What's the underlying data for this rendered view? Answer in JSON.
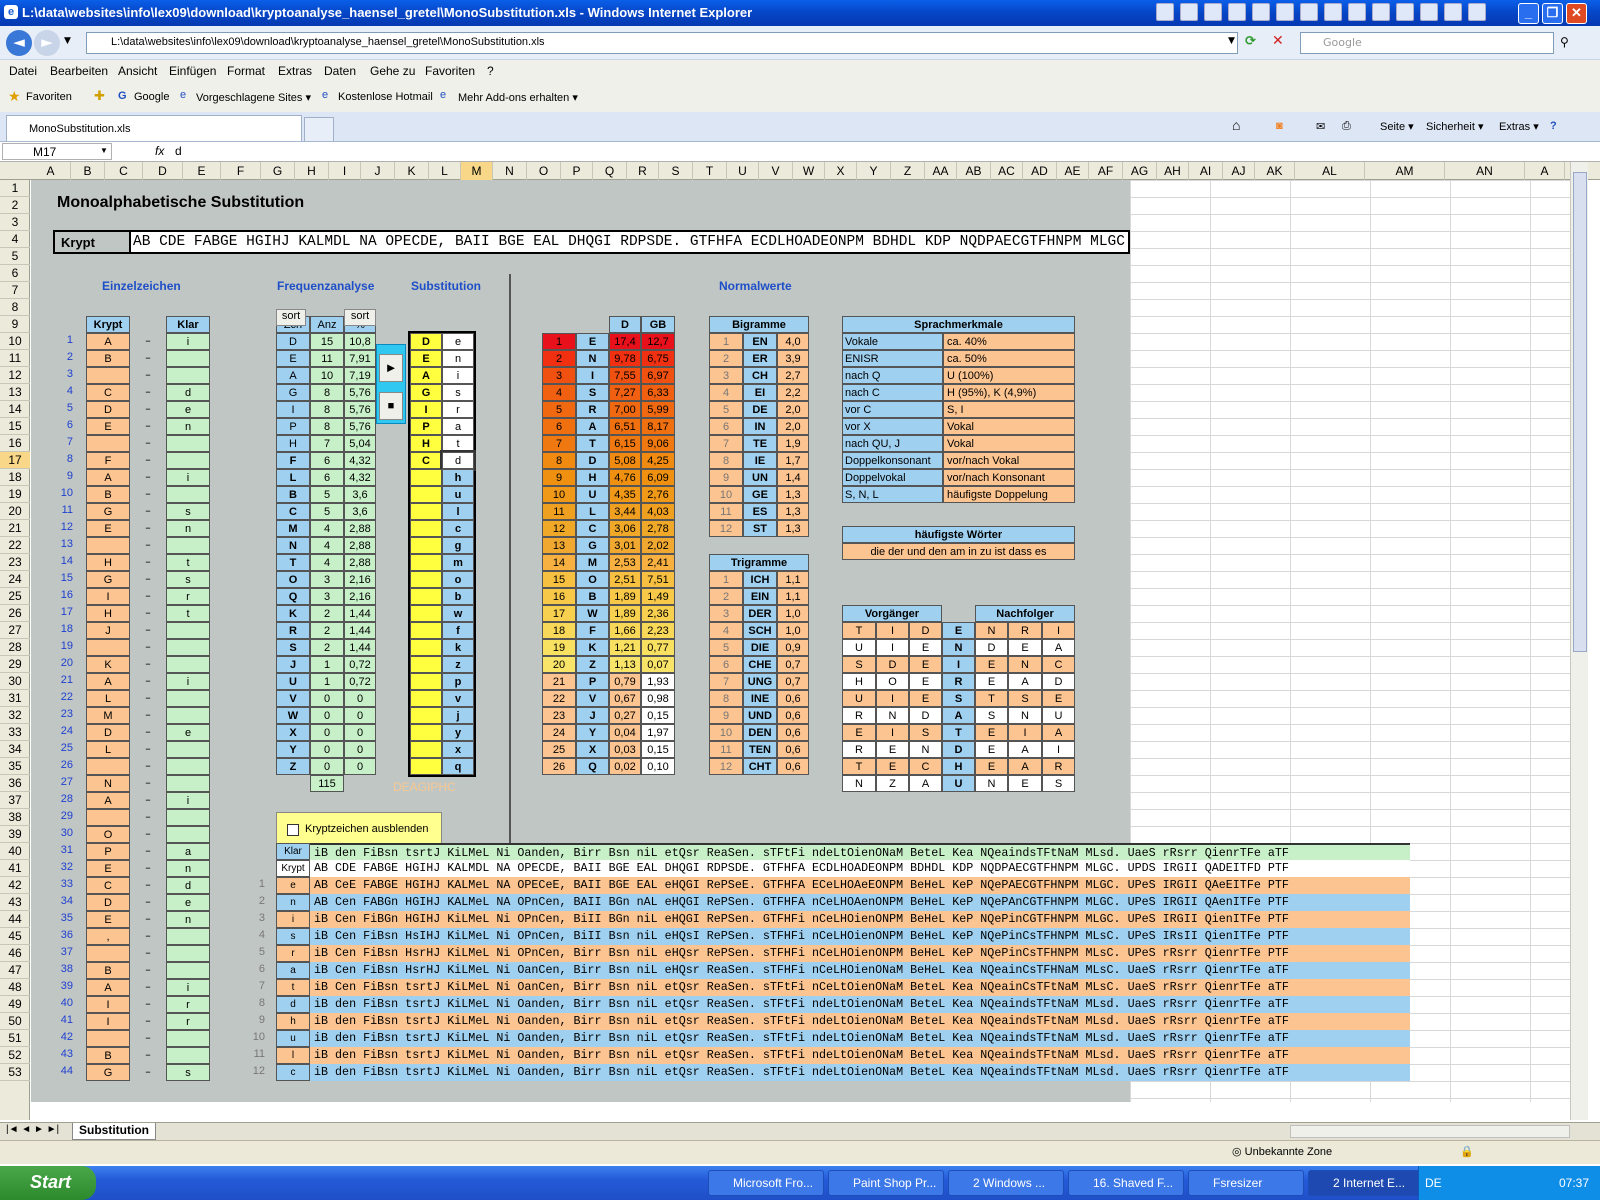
{
  "window": {
    "title": "L:\\data\\websites\\info\\lex09\\download\\kryptoanalyse_haensel_gretel\\MonoSubstitution.xls - Windows Internet Explorer"
  },
  "address": {
    "url": "L:\\data\\websites\\info\\lex09\\download\\kryptoanalyse_haensel_gretel\\MonoSubstitution.xls",
    "search_placeholder": "Google"
  },
  "menu": [
    "Datei",
    "Bearbeiten",
    "Ansicht",
    "Einfügen",
    "Format",
    "Extras",
    "Daten",
    "Gehe zu",
    "Favoriten",
    "?"
  ],
  "favorites": {
    "label": "Favoriten",
    "items": [
      "Google",
      "Vorgeschlagene Sites ▾",
      "Kostenlose Hotmail",
      "Mehr Add-ons erhalten ▾"
    ]
  },
  "tab": {
    "label": "MonoSubstitution.xls"
  },
  "toolbar": {
    "seite": "Seite ▾",
    "sicherheit": "Sicherheit ▾",
    "extras": "Extras ▾"
  },
  "formula": {
    "cell": "M17",
    "fx": "fx",
    "value": "d"
  },
  "columns": [
    "A",
    "B",
    "C",
    "D",
    "E",
    "F",
    "G",
    "H",
    "I",
    "J",
    "K",
    "L",
    "M",
    "N",
    "O",
    "P",
    "Q",
    "R",
    "S",
    "T",
    "U",
    "V",
    "W",
    "X",
    "Y",
    "Z",
    "AA",
    "AB",
    "AC",
    "AD",
    "AE",
    "AF",
    "AG",
    "AH",
    "AI",
    "AJ",
    "AK",
    "AL",
    "AM",
    "AN",
    "A"
  ],
  "rows": [
    "1",
    "2",
    "3",
    "4",
    "5",
    "6",
    "7",
    "8",
    "9",
    "10",
    "11",
    "12",
    "13",
    "14",
    "15",
    "16",
    "17",
    "18",
    "19",
    "20",
    "21",
    "22",
    "23",
    "24",
    "25",
    "26",
    "27",
    "28",
    "29",
    "30",
    "31",
    "32",
    "33",
    "34",
    "35",
    "36",
    "37",
    "38",
    "39",
    "40",
    "41",
    "42",
    "43",
    "44",
    "45",
    "46",
    "47",
    "48",
    "49",
    "50",
    "51",
    "52",
    "53"
  ],
  "sheet": {
    "title": "Monoalphabetische Substitution",
    "krypt_label": "Krypt",
    "krypt_text": "AB CDE FABGE HGIHJ KALMDL NA OPECDE, BAII BGE EAL DHQGI RDPSDE. GTFHFA ECDLHOADEONPM BDHDL KDP NQDPAECGTFHNPM MLGC. UPDS IRGII QADE",
    "sec_einzel": "Einzelzeichen",
    "sec_freq": "Frequenzanalyse",
    "sec_subst": "Substitution",
    "sec_normal": "Normalwerte",
    "einzel_hdr": [
      "Krypt",
      "Klar"
    ],
    "einzel": [
      [
        "1",
        "A",
        "i"
      ],
      [
        "2",
        "B",
        ""
      ],
      [
        "3",
        "",
        ""
      ],
      [
        "4",
        "C",
        "d"
      ],
      [
        "5",
        "D",
        "e"
      ],
      [
        "6",
        "E",
        "n"
      ],
      [
        "7",
        "",
        ""
      ],
      [
        "8",
        "F",
        ""
      ],
      [
        "9",
        "A",
        "i"
      ],
      [
        "10",
        "B",
        ""
      ],
      [
        "11",
        "G",
        "s"
      ],
      [
        "12",
        "E",
        "n"
      ],
      [
        "13",
        "",
        ""
      ],
      [
        "14",
        "H",
        "t"
      ],
      [
        "15",
        "G",
        "s"
      ],
      [
        "16",
        "I",
        "r"
      ],
      [
        "17",
        "H",
        "t"
      ],
      [
        "18",
        "J",
        ""
      ],
      [
        "19",
        "",
        ""
      ],
      [
        "20",
        "K",
        ""
      ],
      [
        "21",
        "A",
        "i"
      ],
      [
        "22",
        "L",
        ""
      ],
      [
        "23",
        "M",
        ""
      ],
      [
        "24",
        "D",
        "e"
      ],
      [
        "25",
        "L",
        ""
      ],
      [
        "26",
        "",
        ""
      ],
      [
        "27",
        "N",
        ""
      ],
      [
        "28",
        "A",
        "i"
      ],
      [
        "29",
        "",
        ""
      ],
      [
        "30",
        "O",
        ""
      ],
      [
        "31",
        "P",
        "a"
      ],
      [
        "32",
        "E",
        "n"
      ],
      [
        "33",
        "C",
        "d"
      ],
      [
        "34",
        "D",
        "e"
      ],
      [
        "35",
        "E",
        "n"
      ],
      [
        "36",
        ",",
        ""
      ],
      [
        "37",
        "",
        ""
      ],
      [
        "38",
        "B",
        ""
      ],
      [
        "39",
        "A",
        "i"
      ],
      [
        "40",
        "I",
        "r"
      ],
      [
        "41",
        "I",
        "r"
      ],
      [
        "42",
        "",
        ""
      ],
      [
        "43",
        "B",
        ""
      ],
      [
        "44",
        "G",
        "s"
      ]
    ],
    "sort_label": "sort",
    "freq_hdr": [
      "Zch",
      "Anz",
      "%"
    ],
    "freq": [
      [
        "D",
        "15",
        "10,8"
      ],
      [
        "E",
        "11",
        "7,91"
      ],
      [
        "A",
        "10",
        "7,19"
      ],
      [
        "G",
        "8",
        "5,76"
      ],
      [
        "I",
        "8",
        "5,76"
      ],
      [
        "P",
        "8",
        "5,76"
      ],
      [
        "H",
        "7",
        "5,04"
      ],
      [
        "F",
        "6",
        "4,32"
      ],
      [
        "L",
        "6",
        "4,32"
      ],
      [
        "B",
        "5",
        "3,6"
      ],
      [
        "C",
        "5",
        "3,6"
      ],
      [
        "M",
        "4",
        "2,88"
      ],
      [
        "N",
        "4",
        "2,88"
      ],
      [
        "T",
        "4",
        "2,88"
      ],
      [
        "O",
        "3",
        "2,16"
      ],
      [
        "Q",
        "3",
        "2,16"
      ],
      [
        "K",
        "2",
        "1,44"
      ],
      [
        "R",
        "2",
        "1,44"
      ],
      [
        "S",
        "2",
        "1,44"
      ],
      [
        "J",
        "1",
        "0,72"
      ],
      [
        "U",
        "1",
        "0,72"
      ],
      [
        "V",
        "0",
        "0"
      ],
      [
        "W",
        "0",
        "0"
      ],
      [
        "X",
        "0",
        "0"
      ],
      [
        "Y",
        "0",
        "0"
      ],
      [
        "Z",
        "0",
        "0"
      ]
    ],
    "freq_total": "115",
    "subst_left": [
      "D",
      "E",
      "A",
      "G",
      "I",
      "P",
      "H",
      "C",
      "",
      "",
      "",
      "",
      "",
      "",
      "",
      "",
      "",
      "",
      "",
      "",
      "",
      "",
      "",
      "",
      "",
      ""
    ],
    "subst_right": [
      "e",
      "n",
      "i",
      "s",
      "r",
      "a",
      "t",
      "d",
      "h",
      "u",
      "l",
      "c",
      "g",
      "m",
      "o",
      "b",
      "w",
      "f",
      "k",
      "z",
      "p",
      "v",
      "j",
      "y",
      "x",
      "q"
    ],
    "subst_note": "DEAGIPHC",
    "play_btn": "►",
    "stop_btn": "■",
    "normal_hdr": [
      "D",
      "GB"
    ],
    "normal": [
      [
        "1",
        "E",
        "17,4",
        "12,7"
      ],
      [
        "2",
        "N",
        "9,78",
        "6,75"
      ],
      [
        "3",
        "I",
        "7,55",
        "6,97"
      ],
      [
        "4",
        "S",
        "7,27",
        "6,33"
      ],
      [
        "5",
        "R",
        "7,00",
        "5,99"
      ],
      [
        "6",
        "A",
        "6,51",
        "8,17"
      ],
      [
        "7",
        "T",
        "6,15",
        "9,06"
      ],
      [
        "8",
        "D",
        "5,08",
        "4,25"
      ],
      [
        "9",
        "H",
        "4,76",
        "6,09"
      ],
      [
        "10",
        "U",
        "4,35",
        "2,76"
      ],
      [
        "11",
        "L",
        "3,44",
        "4,03"
      ],
      [
        "12",
        "C",
        "3,06",
        "2,78"
      ],
      [
        "13",
        "G",
        "3,01",
        "2,02"
      ],
      [
        "14",
        "M",
        "2,53",
        "2,41"
      ],
      [
        "15",
        "O",
        "2,51",
        "7,51"
      ],
      [
        "16",
        "B",
        "1,89",
        "1,49"
      ],
      [
        "17",
        "W",
        "1,89",
        "2,36"
      ],
      [
        "18",
        "F",
        "1,66",
        "2,23"
      ],
      [
        "19",
        "K",
        "1,21",
        "0,77"
      ],
      [
        "20",
        "Z",
        "1,13",
        "0,07"
      ],
      [
        "21",
        "P",
        "0,79",
        "1,93"
      ],
      [
        "22",
        "V",
        "0,67",
        "0,98"
      ],
      [
        "23",
        "J",
        "0,27",
        "0,15"
      ],
      [
        "24",
        "Y",
        "0,04",
        "1,97"
      ],
      [
        "25",
        "X",
        "0,03",
        "0,15"
      ],
      [
        "26",
        "Q",
        "0,02",
        "0,10"
      ]
    ],
    "normal_colors": [
      "#e8101a",
      "#f03010",
      "#f05010",
      "#f06010",
      "#f06810",
      "#f07010",
      "#f07810",
      "#f08a10",
      "#f09010",
      "#f09818",
      "#f0a020",
      "#f0a828",
      "#f0a830",
      "#f8b040",
      "#f8c040",
      "#f8c848",
      "#f8d050",
      "#f8d858",
      "#f8e060",
      "#f8e468",
      "#fcc490",
      "#fcc490",
      "#fcc490",
      "#fcc490",
      "#fcc490",
      "#fcc490"
    ],
    "bigramme_title": "Bigramme",
    "bigramme": [
      [
        "1",
        "EN",
        "4,0"
      ],
      [
        "2",
        "ER",
        "3,9"
      ],
      [
        "3",
        "CH",
        "2,7"
      ],
      [
        "4",
        "EI",
        "2,2"
      ],
      [
        "5",
        "DE",
        "2,0"
      ],
      [
        "6",
        "IN",
        "2,0"
      ],
      [
        "7",
        "TE",
        "1,9"
      ],
      [
        "8",
        "IE",
        "1,7"
      ],
      [
        "9",
        "UN",
        "1,4"
      ],
      [
        "10",
        "GE",
        "1,3"
      ],
      [
        "11",
        "ES",
        "1,3"
      ],
      [
        "12",
        "ST",
        "1,3"
      ]
    ],
    "trigramme_title": "Trigramme",
    "trigramme": [
      [
        "1",
        "ICH",
        "1,1"
      ],
      [
        "2",
        "EIN",
        "1,1"
      ],
      [
        "3",
        "DER",
        "1,0"
      ],
      [
        "4",
        "SCH",
        "1,0"
      ],
      [
        "5",
        "DIE",
        "0,9"
      ],
      [
        "6",
        "CHE",
        "0,7"
      ],
      [
        "7",
        "UNG",
        "0,7"
      ],
      [
        "8",
        "INE",
        "0,6"
      ],
      [
        "9",
        "UND",
        "0,6"
      ],
      [
        "10",
        "DEN",
        "0,6"
      ],
      [
        "11",
        "TEN",
        "0,6"
      ],
      [
        "12",
        "CHT",
        "0,6"
      ]
    ],
    "sprach_title": "Sprachmerkmale",
    "sprach": [
      [
        "Vokale",
        "ca. 40%"
      ],
      [
        "ENISR",
        "ca. 50%"
      ],
      [
        "nach Q",
        "U (100%)"
      ],
      [
        "nach C",
        "H (95%), K (4,9%)"
      ],
      [
        "vor C",
        "S, I"
      ],
      [
        "vor X",
        "Vokal"
      ],
      [
        "nach QU, J",
        "Vokal"
      ],
      [
        "Doppelkonsonant",
        "vor/nach Vokal"
      ],
      [
        "Doppelvokal",
        "vor/nach Konsonant"
      ],
      [
        "S, N, L",
        "häufigste Doppelung"
      ]
    ],
    "woerter_title": "häufigste Wörter",
    "woerter": "die der und den am in zu ist dass es",
    "vorg_title": "Vorgänger",
    "nachf_title": "Nachfolger",
    "vn_top": [
      "T",
      "I",
      "D",
      "E",
      "N",
      "R",
      "I"
    ],
    "vn": [
      [
        "U",
        "I",
        "E",
        "N",
        "D",
        "E",
        "A"
      ],
      [
        "S",
        "D",
        "E",
        "I",
        "E",
        "N",
        "C"
      ],
      [
        "H",
        "O",
        "E",
        "R",
        "E",
        "A",
        "D"
      ],
      [
        "U",
        "I",
        "E",
        "S",
        "T",
        "S",
        "E"
      ],
      [
        "R",
        "N",
        "D",
        "A",
        "S",
        "N",
        "U"
      ],
      [
        "E",
        "I",
        "S",
        "T",
        "E",
        "I",
        "A"
      ],
      [
        "R",
        "E",
        "N",
        "D",
        "E",
        "A",
        "I"
      ],
      [
        "T",
        "E",
        "C",
        "H",
        "E",
        "A",
        "R"
      ],
      [
        "N",
        "Z",
        "A",
        "U",
        "N",
        "E",
        "S"
      ]
    ],
    "checkbox_label": "Kryptzeichen ausblenden",
    "klar_label": "Klar",
    "krypt_row_label": "Krypt",
    "klar_text": "iB den FiBsn tsrtJ KiLMeL Ni Oanden, Birr Bsn niL etQsr ReaSen. sTFtFi ndeLtOienONaM BeteL Kea NQeaindsTFtNaM MLsd. UaeS rRsrr QienrTFe aTF",
    "krypt_row_text": "AB CDE FABGE HGIHJ KALMDL NA OPECDE, BAII BGE EAL DHQGI RDPSDE. GTFHFA ECDLHOADEONPM BDHDL KDP NQDPAECGTFHNPM MLGC. UPDS IRGII QADEITFD PTF",
    "trial": [
      [
        "1",
        "e",
        "AB CeE FABGE HGIHJ KALMeL NA OPECeE, BAII BGE EAL eHQGI RePSeE. GTFHFA ECeLHOAeEONPM BeHeL KeP NQePAECGTFHNPM MLGC. UPeS IRGII QAeEITFe PTF"
      ],
      [
        "2",
        "n",
        "AB Cen FABGn HGIHJ KALMeL NA OPnCen, BAII BGn nAL eHQGI RePSen. GTFHFA nCeLHOAenONPM BeHeL KeP NQePAnCGTFHNPM MLGC. UPeS IRGII QAenITFe PTF"
      ],
      [
        "3",
        "i",
        "iB Cen FiBGn HGIHJ KiLMeL Ni OPnCen, BiII BGn niL eHQGI RePSen. GTFHFi nCeLHOienONPM BeHeL KeP NQePinCGTFHNPM MLGC. UPeS IRGII QienITFe PTF"
      ],
      [
        "4",
        "s",
        "iB Cen FiBsn HsIHJ KiLMeL Ni OPnCen, BiII Bsn niL eHQsI RePSen. sTFHFi nCeLHOienONPM BeHeL KeP NQePinCsTFHNPM MLsC. UPeS IRsII QienITFe PTF"
      ],
      [
        "5",
        "r",
        "iB Cen FiBsn HsrHJ KiLMeL Ni OPnCen, Birr Bsn niL eHQsr RePSen. sTFHFi nCeLHOienONPM BeHeL KeP NQePinCsTFHNPM MLsC. UPeS rRsrr QienrTFe PTF"
      ],
      [
        "6",
        "a",
        "iB Cen FiBsn HsrHJ KiLMeL Ni OanCen, Birr Bsn niL eHQsr ReaSen. sTFHFi nCeLHOienONaM BeHeL Kea NQeainCsTFHNaM MLsC. UaeS rRsrr QienrTFe aTF"
      ],
      [
        "7",
        "t",
        "iB Cen FiBsn tsrtJ KiLMeL Ni OanCen, Birr Bsn niL etQsr ReaSen. sTFtFi nCeLtOienONaM BeteL Kea NQeainCsTFtNaM MLsC. UaeS rRsrr QienrTFe aTF"
      ],
      [
        "8",
        "d",
        "iB den FiBsn tsrtJ KiLMeL Ni Oanden, Birr Bsn niL etQsr ReaSen. sTFtFi ndeLtOienONaM BeteL Kea NQeaindsTFtNaM MLsd. UaeS rRsrr QienrTFe aTF"
      ],
      [
        "9",
        "h",
        "iB den FiBsn tsrtJ KiLMeL Ni Oanden, Birr Bsn niL etQsr ReaSen. sTFtFi ndeLtOienONaM BeteL Kea NQeaindsTFtNaM MLsd. UaeS rRsrr QienrTFe aTF"
      ],
      [
        "10",
        "u",
        "iB den FiBsn tsrtJ KiLMeL Ni Oanden, Birr Bsn niL etQsr ReaSen. sTFtFi ndeLtOienONaM BeteL Kea NQeaindsTFtNaM MLsd. UaeS rRsrr QienrTFe aTF"
      ],
      [
        "11",
        "l",
        "iB den FiBsn tsrtJ KiLMeL Ni Oanden, Birr Bsn niL etQsr ReaSen. sTFtFi ndeLtOienONaM BeteL Kea NQeaindsTFtNaM MLsd. UaeS rRsrr QienrTFe aTF"
      ],
      [
        "12",
        "c",
        "iB den FiBsn tsrtJ KiLMeL Ni Oanden, Birr Bsn niL etQsr ReaSen. sTFtFi ndeLtOienONaM BeteL Kea NQeaindsTFtNaM MLsd. UaeS rRsrr QienrTFe aTF"
      ]
    ]
  },
  "sheet_tab": "Substitution",
  "status": {
    "zone": "Unbekannte Zone"
  },
  "taskbar": {
    "start": "Start",
    "tasks": [
      "Microsoft Fro...",
      "Paint Shop Pr...",
      "2 Windows ...",
      "16. Shaved F...",
      "Fsresizer",
      "2 Internet E..."
    ],
    "lang": "DE",
    "clock": "07:37"
  }
}
